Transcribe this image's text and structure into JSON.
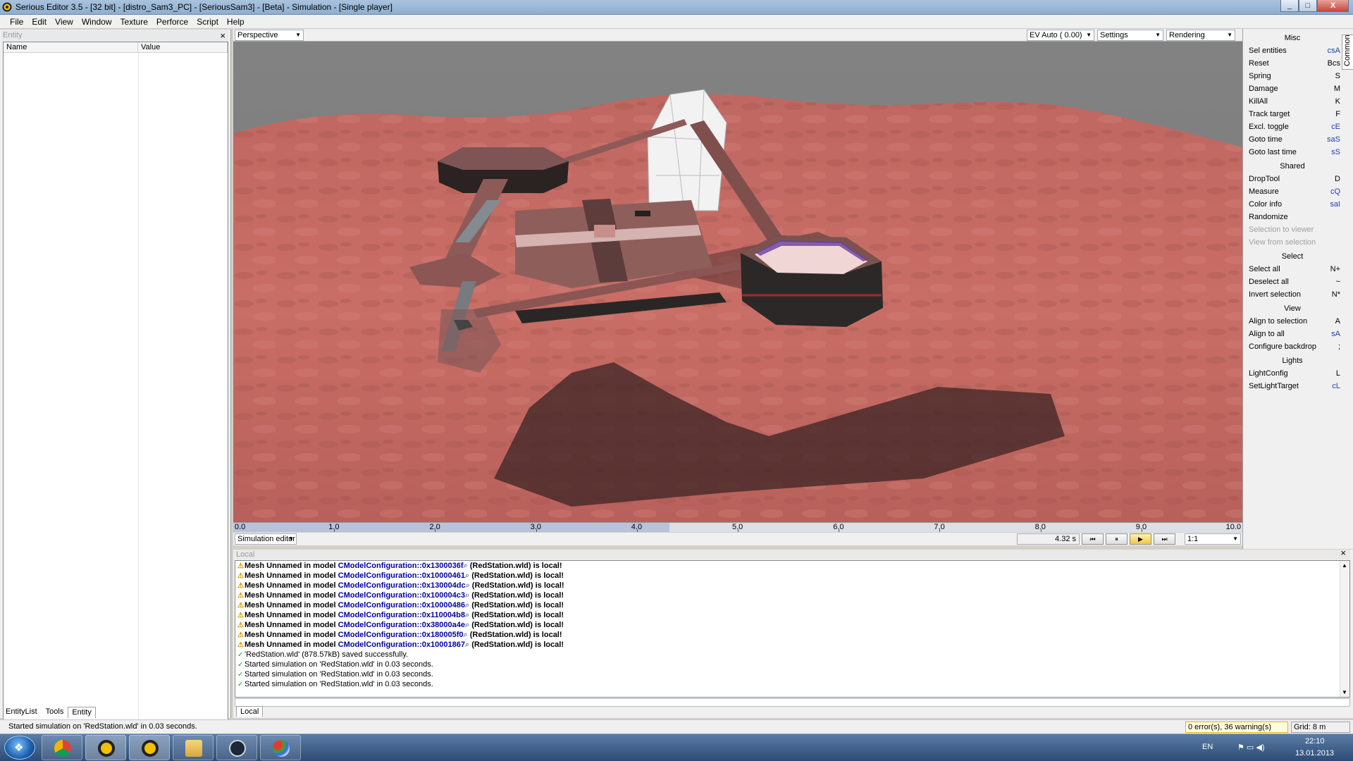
{
  "window": {
    "title": "Serious Editor 3.5 - [32 bit] - [distro_Sam3_PC] - [SeriousSam3] - [Beta] - Simulation - [Single player]",
    "minimize": "_",
    "maximize": "□",
    "close": "X"
  },
  "menu": [
    "File",
    "Edit",
    "View",
    "Window",
    "Texture",
    "Perforce",
    "Script",
    "Help"
  ],
  "left_panel": {
    "header": "Entity",
    "close": "×",
    "columns": [
      "Name",
      "Value"
    ],
    "tabs": [
      "EntityList",
      "Tools",
      "Entity"
    ],
    "active_tab": "Entity"
  },
  "viewport_toolbar": {
    "view_mode": "Perspective",
    "exposure": "EV Auto ( 0.00)",
    "settings": "Settings",
    "rendering": "Rendering"
  },
  "timeline": {
    "labels": [
      "0.0",
      "1.0",
      "2.0",
      "3.0",
      "4.0",
      "5.0",
      "6.0",
      "7.0",
      "8.0",
      "9.0",
      "10.0"
    ],
    "min": 0,
    "max": 10,
    "position": 4.32
  },
  "sim_bar": {
    "mode": "Simulation editor",
    "time": "4.32 s",
    "ratio": "1:1",
    "buttons": [
      "⏮",
      "⏸",
      "▶",
      "⏭"
    ]
  },
  "log": {
    "header": "Local",
    "close": "×",
    "tab": "Local",
    "lines": [
      {
        "kind": "warn",
        "pre": "Mesh Unnamed in model ",
        "link": "CModelConfiguration::0x1300036f",
        "post": " (RedStation.wld) is local!"
      },
      {
        "kind": "warn",
        "pre": "Mesh Unnamed in model ",
        "link": "CModelConfiguration::0x10000461",
        "post": " (RedStation.wld) is local!"
      },
      {
        "kind": "warn",
        "pre": "Mesh Unnamed in model ",
        "link": "CModelConfiguration::0x130004dc",
        "post": " (RedStation.wld) is local!"
      },
      {
        "kind": "warn",
        "pre": "Mesh Unnamed in model ",
        "link": "CModelConfiguration::0x100004c3",
        "post": " (RedStation.wld) is local!"
      },
      {
        "kind": "warn",
        "pre": "Mesh Unnamed in model ",
        "link": "CModelConfiguration::0x10000486",
        "post": " (RedStation.wld) is local!"
      },
      {
        "kind": "warn",
        "pre": "Mesh Unnamed in model ",
        "link": "CModelConfiguration::0x110004b8",
        "post": " (RedStation.wld) is local!"
      },
      {
        "kind": "warn",
        "pre": "Mesh Unnamed in model ",
        "link": "CModelConfiguration::0x38000a4e",
        "post": " (RedStation.wld) is local!"
      },
      {
        "kind": "warn",
        "pre": "Mesh Unnamed in model ",
        "link": "CModelConfiguration::0x180005f0",
        "post": " (RedStation.wld) is local!"
      },
      {
        "kind": "warn",
        "pre": "Mesh Unnamed in model ",
        "link": "CModelConfiguration::0x10001867",
        "post": " (RedStation.wld) is local!"
      },
      {
        "kind": "ok",
        "pre": "'RedStation.wld' (878.57kB) saved successfully.",
        "link": "",
        "post": ""
      },
      {
        "kind": "ok",
        "pre": "Started simulation on 'RedStation.wld' in 0.03 seconds.",
        "link": "",
        "post": ""
      },
      {
        "kind": "ok",
        "pre": "Started simulation on 'RedStation.wld' in 0.03 seconds.",
        "link": "",
        "post": ""
      },
      {
        "kind": "ok",
        "pre": "Started simulation on 'RedStation.wld' in 0.03 seconds.",
        "link": "",
        "post": ""
      }
    ]
  },
  "right_panel": {
    "vertical_tab": "Common",
    "sections": [
      {
        "title": "Misc",
        "items": [
          {
            "label": "Sel entities",
            "key": "csA",
            "blue": true
          },
          {
            "label": "Reset",
            "key": "Bcs",
            "blue": false
          },
          {
            "label": "Spring",
            "key": "S",
            "blue": false
          },
          {
            "label": "Damage",
            "key": "M",
            "blue": false
          },
          {
            "label": "KillAll",
            "key": "K",
            "blue": false
          },
          {
            "label": "Track target",
            "key": "F",
            "blue": false
          },
          {
            "label": "Excl. toggle",
            "key": "cE",
            "blue": true
          },
          {
            "label": "Goto time",
            "key": "saS",
            "blue": true
          },
          {
            "label": "Goto last time",
            "key": "sS",
            "blue": true
          }
        ]
      },
      {
        "title": "Shared",
        "items": [
          {
            "label": "DropTool",
            "key": "D",
            "blue": false
          },
          {
            "label": "Measure",
            "key": "cQ",
            "blue": true
          },
          {
            "label": "Color info",
            "key": "saI",
            "blue": true
          },
          {
            "label": "Randomize",
            "key": "",
            "blue": false
          },
          {
            "label": "Selection to viewer",
            "key": "",
            "blue": false,
            "disabled": true
          },
          {
            "label": "View from selection",
            "key": "",
            "blue": false,
            "disabled": true
          }
        ]
      },
      {
        "title": "Select",
        "items": [
          {
            "label": "Select all",
            "key": "N+",
            "blue": false
          },
          {
            "label": "Deselect all",
            "key": "~",
            "blue": false
          },
          {
            "label": "Invert selection",
            "key": "N*",
            "blue": false
          }
        ]
      },
      {
        "title": "View",
        "items": [
          {
            "label": "Align to selection",
            "key": "A",
            "blue": false
          },
          {
            "label": "Align to all",
            "key": "sA",
            "blue": true
          },
          {
            "label": "Configure backdrop",
            "key": ";",
            "blue": false
          }
        ]
      },
      {
        "title": "Lights",
        "items": [
          {
            "label": "LightConfig",
            "key": "L",
            "blue": false
          },
          {
            "label": "SetLightTarget",
            "key": "cL",
            "blue": true
          }
        ]
      }
    ]
  },
  "status_bar": {
    "message": "Started simulation on 'RedStation.wld' in 0.03 seconds.",
    "warnings": "0 error(s), 36 warning(s)",
    "grid": "Grid: 8 m"
  },
  "taskbar": {
    "apps": [
      "chrome-icon",
      "serious-editor-icon",
      "serious-editor-icon",
      "explorer-icon",
      "steam-icon",
      "paint-icon"
    ],
    "language": "EN",
    "time": "22:10",
    "date": "13.01.2013"
  },
  "colors": {
    "sky": "#7f7f7f",
    "terrain": "#c76a63",
    "accent": "#f2c743"
  }
}
